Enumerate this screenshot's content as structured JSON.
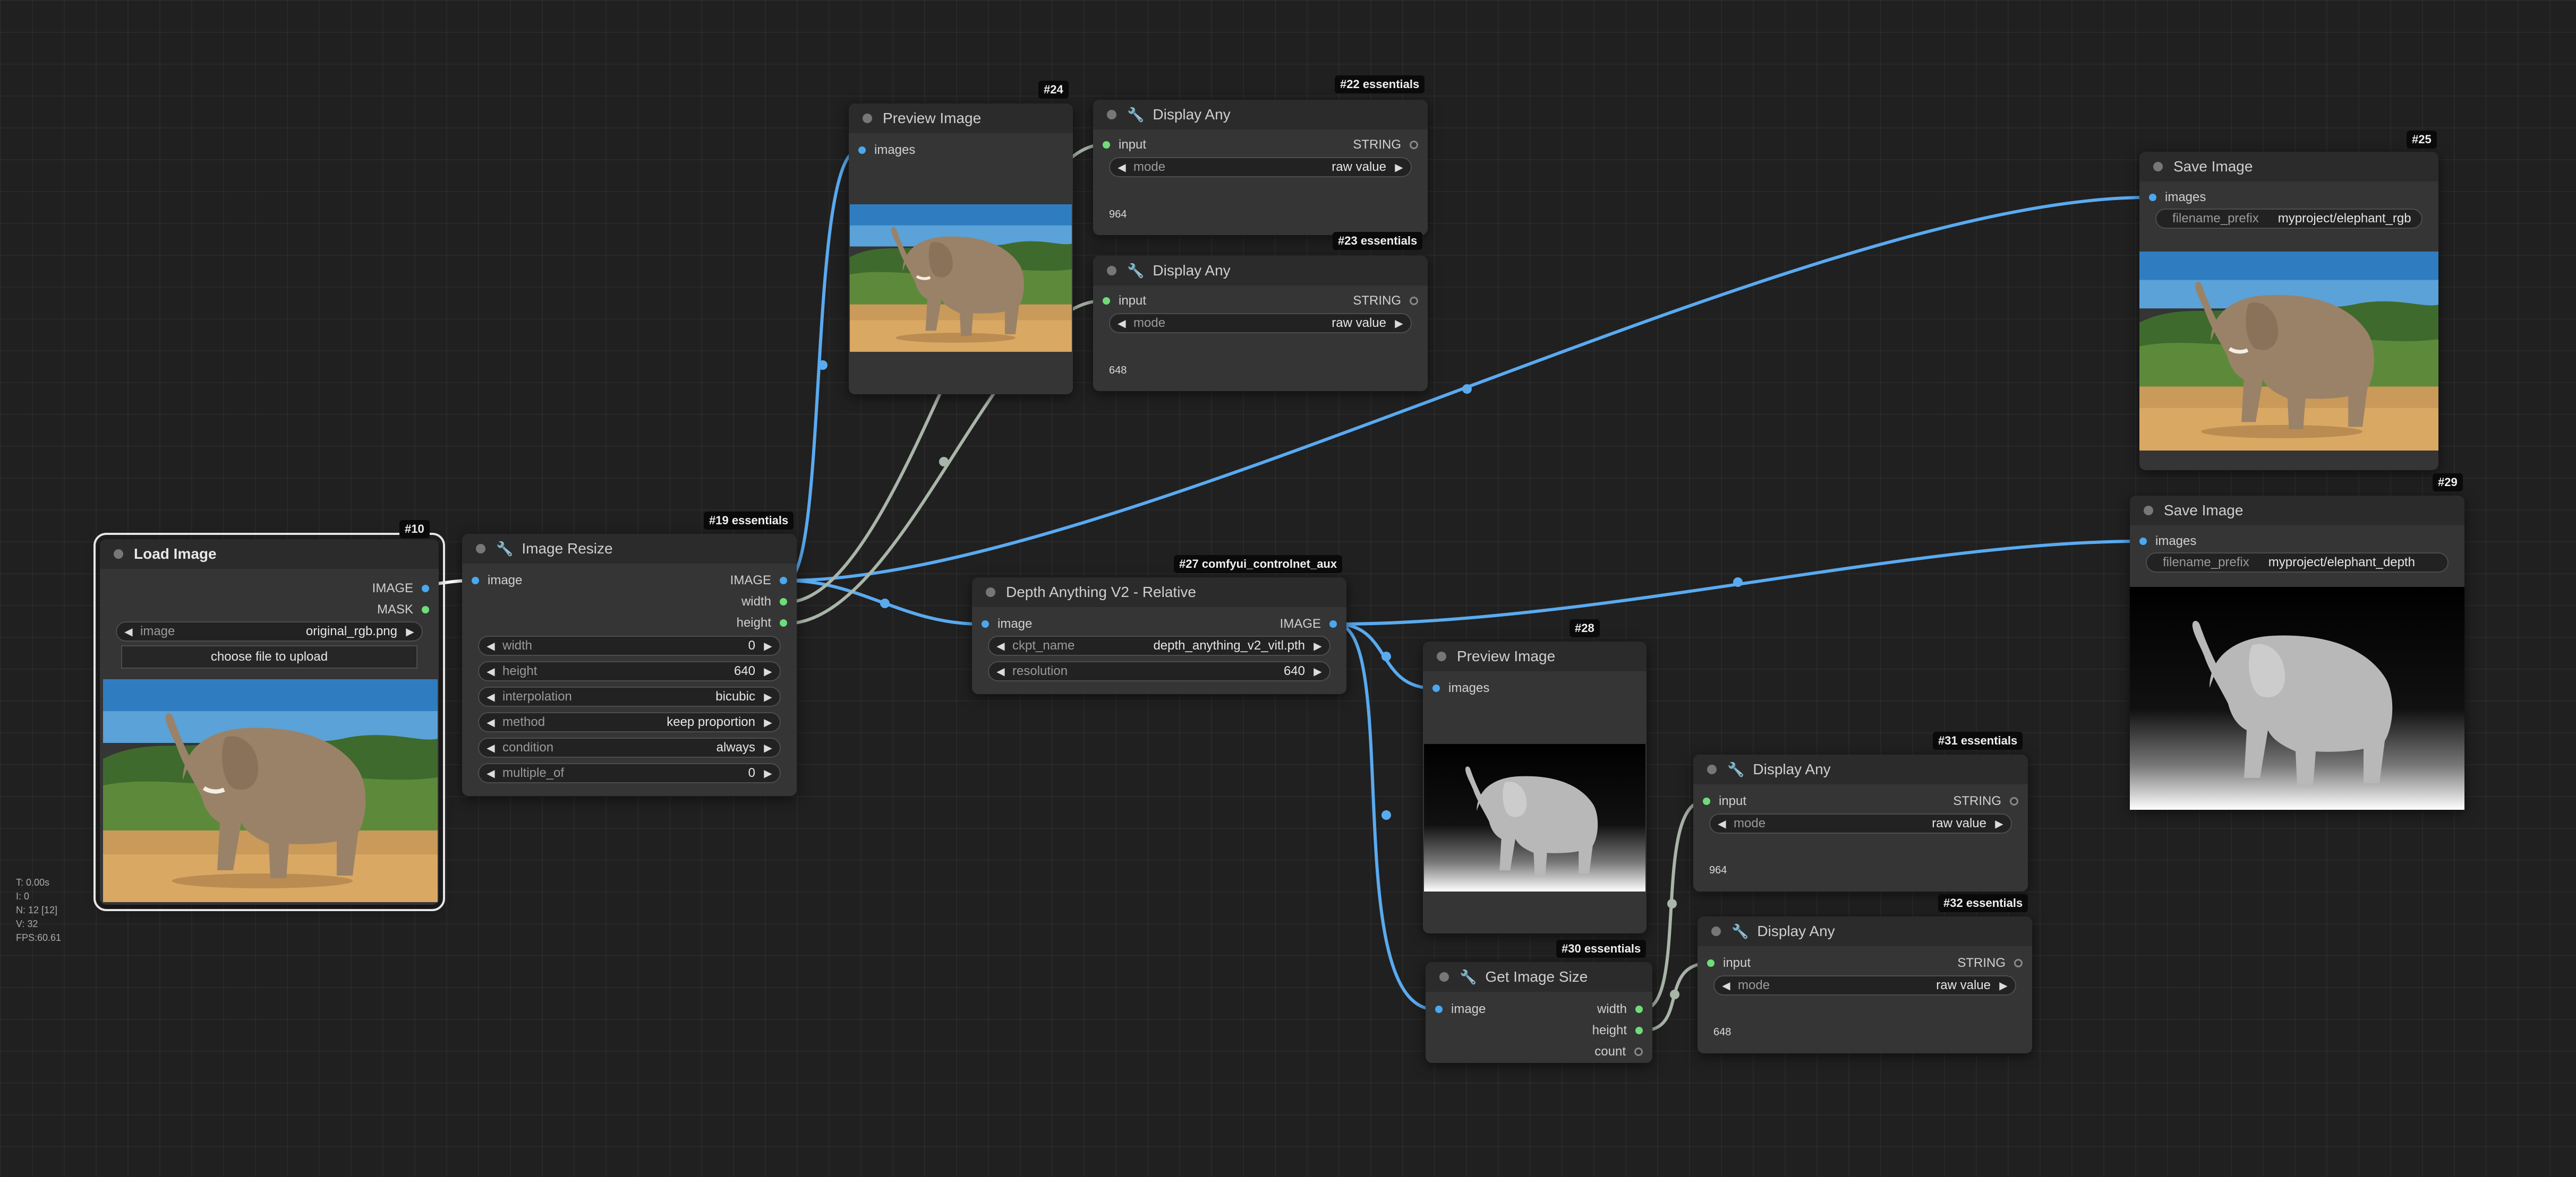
{
  "colors": {
    "canvas_bg": "#202020",
    "node_body": "#353535",
    "node_header": "#2b2b2b",
    "image_wire": "#5aaaf0",
    "int_wire": "#aab5aa",
    "image_socket": "#4aa8f0",
    "int_socket": "#6fdc7a"
  },
  "nodes": {
    "load_image": {
      "badge": "#10",
      "title": "Load Image",
      "outputs": [
        "IMAGE",
        "MASK"
      ],
      "image_widget": {
        "label": "image",
        "value": "original_rgb.png"
      },
      "upload_button": "choose file to upload"
    },
    "image_resize": {
      "badge": "#19 essentials",
      "title": "Image Resize",
      "input": "image",
      "outputs": [
        "IMAGE",
        "width",
        "height"
      ],
      "widgets": [
        {
          "label": "width",
          "value": "0"
        },
        {
          "label": "height",
          "value": "640"
        },
        {
          "label": "interpolation",
          "value": "bicubic"
        },
        {
          "label": "method",
          "value": "keep proportion"
        },
        {
          "label": "condition",
          "value": "always"
        },
        {
          "label": "multiple_of",
          "value": "0"
        }
      ]
    },
    "preview_24": {
      "badge": "#24",
      "title": "Preview Image",
      "input": "images"
    },
    "display_22": {
      "badge": "#22 essentials",
      "title": "Display Any",
      "input": "input",
      "output": "STRING",
      "mode_label": "mode",
      "mode_value": "raw value",
      "value": "964"
    },
    "display_23": {
      "badge": "#23 essentials",
      "title": "Display Any",
      "input": "input",
      "output": "STRING",
      "mode_label": "mode",
      "mode_value": "raw value",
      "value": "648"
    },
    "depth": {
      "badge": "#27 comfyui_controlnet_aux",
      "title": "Depth Anything V2 - Relative",
      "input": "image",
      "output": "IMAGE",
      "widgets": [
        {
          "label": "ckpt_name",
          "value": "depth_anything_v2_vitl.pth"
        },
        {
          "label": "resolution",
          "value": "640"
        }
      ]
    },
    "preview_28": {
      "badge": "#28",
      "title": "Preview Image",
      "input": "images"
    },
    "get_size": {
      "badge": "#30 essentials",
      "title": "Get Image Size",
      "input": "image",
      "outputs": [
        "width",
        "height",
        "count"
      ]
    },
    "display_31": {
      "badge": "#31 essentials",
      "title": "Display Any",
      "input": "input",
      "output": "STRING",
      "mode_label": "mode",
      "mode_value": "raw value",
      "value": "964"
    },
    "display_32": {
      "badge": "#32 essentials",
      "title": "Display Any",
      "input": "input",
      "output": "STRING",
      "mode_label": "mode",
      "mode_value": "raw value",
      "value": "648"
    },
    "save_25": {
      "badge": "#25",
      "title": "Save Image",
      "input": "images",
      "prefix_label": "filename_prefix",
      "prefix_value": "myproject/elephant_rgb"
    },
    "save_29": {
      "badge": "#29",
      "title": "Save Image",
      "input": "images",
      "prefix_label": "filename_prefix",
      "prefix_value": "myproject/elephant_depth"
    }
  },
  "stats": [
    "T: 0.00s",
    "I: 0",
    "N: 12 [12]",
    "V: 32",
    "FPS:60.61"
  ]
}
